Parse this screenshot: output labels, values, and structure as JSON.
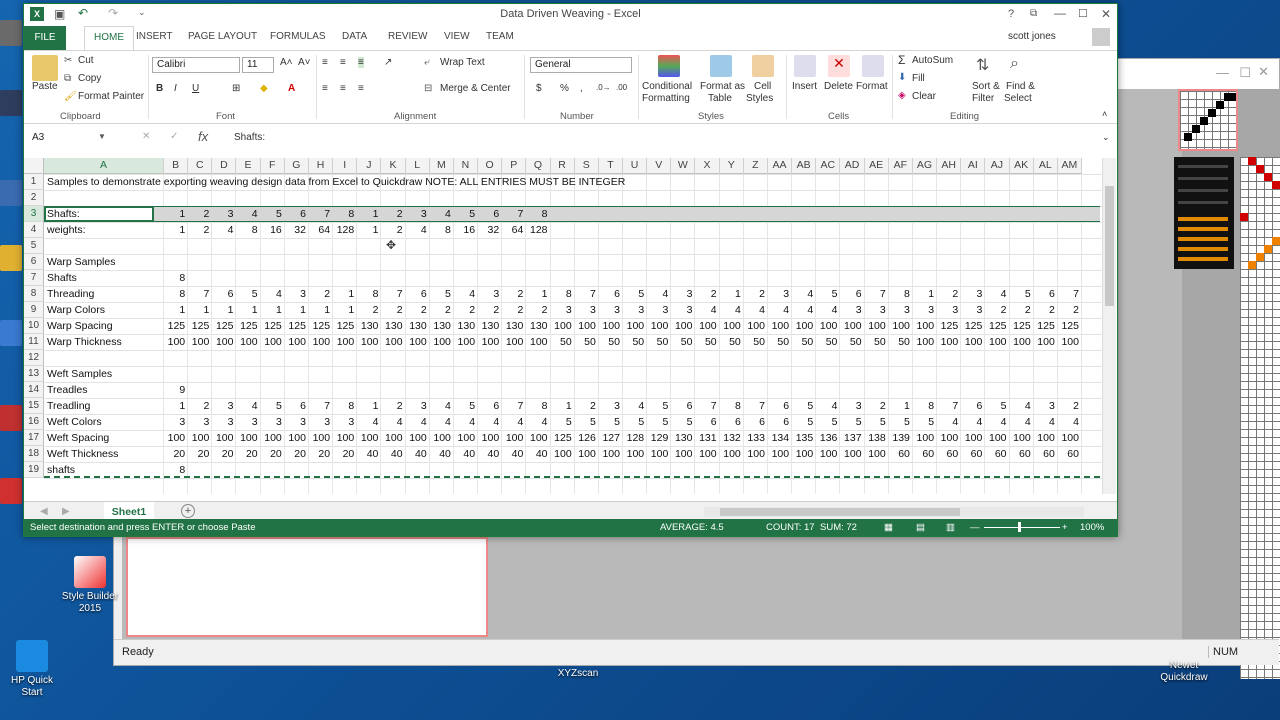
{
  "excel": {
    "window_title": "Data Driven Weaving - Excel",
    "user": "scott jones",
    "tabs": [
      "FILE",
      "HOME",
      "INSERT",
      "PAGE LAYOUT",
      "FORMULAS",
      "DATA",
      "REVIEW",
      "VIEW",
      "TEAM"
    ],
    "ribbon": {
      "clipboard": {
        "paste": "Paste",
        "cut": "Cut",
        "copy": "Copy",
        "format_painter": "Format Painter",
        "label": "Clipboard"
      },
      "font": {
        "name": "Calibri",
        "size": "11",
        "label": "Font"
      },
      "alignment": {
        "wrap": "Wrap Text",
        "merge": "Merge & Center",
        "label": "Alignment"
      },
      "number": {
        "format": "General",
        "label": "Number"
      },
      "styles": {
        "conditional": "Conditional",
        "conditional2": "Formatting",
        "format_as": "Format as",
        "format_as2": "Table",
        "cell": "Cell",
        "cell2": "Styles",
        "label": "Styles"
      },
      "cells": {
        "insert": "Insert",
        "delete": "Delete",
        "format": "Format",
        "label": "Cells"
      },
      "editing": {
        "autosum": "AutoSum",
        "fill": "Fill",
        "clear": "Clear",
        "sort": "Sort &",
        "sort2": "Filter",
        "find": "Find &",
        "find2": "Select",
        "label": "Editing"
      }
    },
    "name_box": "A3",
    "formula": "Shafts:",
    "columns": [
      "A",
      "B",
      "C",
      "D",
      "E",
      "F",
      "G",
      "H",
      "I",
      "J",
      "K",
      "L",
      "M",
      "N",
      "O",
      "P",
      "Q",
      "R",
      "S",
      "T",
      "U",
      "V",
      "W",
      "X",
      "Y",
      "Z",
      "AA",
      "AB",
      "AC",
      "AD",
      "AE",
      "AF",
      "AG",
      "AH",
      "AI",
      "AJ",
      "AK",
      "AL",
      "AM"
    ],
    "rows": [
      {
        "n": "1",
        "label": "Samples to demonstrate exporting weaving design data from Excel to Quickdraw   NOTE: ALL ENTRIES MUST BE INTEGER",
        "values": []
      },
      {
        "n": "2",
        "label": "",
        "values": []
      },
      {
        "n": "3",
        "label": "Shafts:",
        "values": [
          "1",
          "2",
          "3",
          "4",
          "5",
          "6",
          "7",
          "8",
          "1",
          "2",
          "3",
          "4",
          "5",
          "6",
          "7",
          "8"
        ]
      },
      {
        "n": "4",
        "label": "weights:",
        "values": [
          "1",
          "2",
          "4",
          "8",
          "16",
          "32",
          "64",
          "128",
          "1",
          "2",
          "4",
          "8",
          "16",
          "32",
          "64",
          "128"
        ]
      },
      {
        "n": "5",
        "label": "",
        "values": []
      },
      {
        "n": "6",
        "label": "Warp Samples",
        "values": []
      },
      {
        "n": "7",
        "label": "Shafts",
        "values": [
          "8"
        ]
      },
      {
        "n": "8",
        "label": "Threading",
        "values": [
          "8",
          "7",
          "6",
          "5",
          "4",
          "3",
          "2",
          "1",
          "8",
          "7",
          "6",
          "5",
          "4",
          "3",
          "2",
          "1",
          "8",
          "7",
          "6",
          "5",
          "4",
          "3",
          "2",
          "1",
          "2",
          "3",
          "4",
          "5",
          "6",
          "7",
          "8",
          "1",
          "2",
          "3",
          "4",
          "5",
          "6",
          "7"
        ]
      },
      {
        "n": "9",
        "label": "Warp Colors",
        "values": [
          "1",
          "1",
          "1",
          "1",
          "1",
          "1",
          "1",
          "1",
          "2",
          "2",
          "2",
          "2",
          "2",
          "2",
          "2",
          "2",
          "3",
          "3",
          "3",
          "3",
          "3",
          "3",
          "4",
          "4",
          "4",
          "4",
          "4",
          "4",
          "3",
          "3",
          "3",
          "3",
          "3",
          "3",
          "2",
          "2",
          "2",
          "2"
        ]
      },
      {
        "n": "10",
        "label": "Warp Spacing",
        "values": [
          "125",
          "125",
          "125",
          "125",
          "125",
          "125",
          "125",
          "125",
          "130",
          "130",
          "130",
          "130",
          "130",
          "130",
          "130",
          "130",
          "100",
          "100",
          "100",
          "100",
          "100",
          "100",
          "100",
          "100",
          "100",
          "100",
          "100",
          "100",
          "100",
          "100",
          "100",
          "100",
          "125",
          "125",
          "125",
          "125",
          "125",
          "125"
        ]
      },
      {
        "n": "11",
        "label": "Warp Thickness",
        "values": [
          "100",
          "100",
          "100",
          "100",
          "100",
          "100",
          "100",
          "100",
          "100",
          "100",
          "100",
          "100",
          "100",
          "100",
          "100",
          "100",
          "50",
          "50",
          "50",
          "50",
          "50",
          "50",
          "50",
          "50",
          "50",
          "50",
          "50",
          "50",
          "50",
          "50",
          "50",
          "100",
          "100",
          "100",
          "100",
          "100",
          "100",
          "100"
        ]
      },
      {
        "n": "12",
        "label": "",
        "values": []
      },
      {
        "n": "13",
        "label": "Weft Samples",
        "values": []
      },
      {
        "n": "14",
        "label": "Treadles",
        "values": [
          "9"
        ]
      },
      {
        "n": "15",
        "label": "Treadling",
        "values": [
          "1",
          "2",
          "3",
          "4",
          "5",
          "6",
          "7",
          "8",
          "1",
          "2",
          "3",
          "4",
          "5",
          "6",
          "7",
          "8",
          "1",
          "2",
          "3",
          "4",
          "5",
          "6",
          "7",
          "8",
          "7",
          "6",
          "5",
          "4",
          "3",
          "2",
          "1",
          "8",
          "7",
          "6",
          "5",
          "4",
          "3",
          "2"
        ]
      },
      {
        "n": "16",
        "label": "Weft Colors",
        "values": [
          "3",
          "3",
          "3",
          "3",
          "3",
          "3",
          "3",
          "3",
          "4",
          "4",
          "4",
          "4",
          "4",
          "4",
          "4",
          "4",
          "5",
          "5",
          "5",
          "5",
          "5",
          "5",
          "6",
          "6",
          "6",
          "6",
          "5",
          "5",
          "5",
          "5",
          "5",
          "5",
          "4",
          "4",
          "4",
          "4",
          "4",
          "4"
        ]
      },
      {
        "n": "17",
        "label": "Weft Spacing",
        "values": [
          "100",
          "100",
          "100",
          "100",
          "100",
          "100",
          "100",
          "100",
          "100",
          "100",
          "100",
          "100",
          "100",
          "100",
          "100",
          "100",
          "125",
          "126",
          "127",
          "128",
          "129",
          "130",
          "131",
          "132",
          "133",
          "134",
          "135",
          "136",
          "137",
          "138",
          "139",
          "100",
          "100",
          "100",
          "100",
          "100",
          "100",
          "100"
        ]
      },
      {
        "n": "18",
        "label": "Weft Thickness",
        "values": [
          "20",
          "20",
          "20",
          "20",
          "20",
          "20",
          "20",
          "20",
          "40",
          "40",
          "40",
          "40",
          "40",
          "40",
          "40",
          "40",
          "100",
          "100",
          "100",
          "100",
          "100",
          "100",
          "100",
          "100",
          "100",
          "100",
          "100",
          "100",
          "100",
          "100",
          "60",
          "60",
          "60",
          "60",
          "60",
          "60",
          "60",
          "60"
        ]
      },
      {
        "n": "19",
        "label": "shafts",
        "values": [
          "8"
        ]
      }
    ],
    "sheet_tab": "Sheet1",
    "status": {
      "message": "Select destination and press ENTER or choose Paste",
      "average": "AVERAGE: 4.5",
      "count": "COUNT: 17",
      "sum": "SUM: 72",
      "zoom": "100%"
    }
  },
  "quickdraw": {
    "status": "Ready",
    "num": "NUM"
  },
  "desktop": {
    "icons": [
      {
        "label": "Style Builder 2015"
      },
      {
        "label": "HP Quick Start"
      },
      {
        "label": "XYZscan"
      },
      {
        "label": "Newet Quickdraw"
      }
    ]
  },
  "colors": {
    "excel_green": "#217346",
    "weave_red": "#d00000",
    "weave_orange": "#f08000"
  }
}
